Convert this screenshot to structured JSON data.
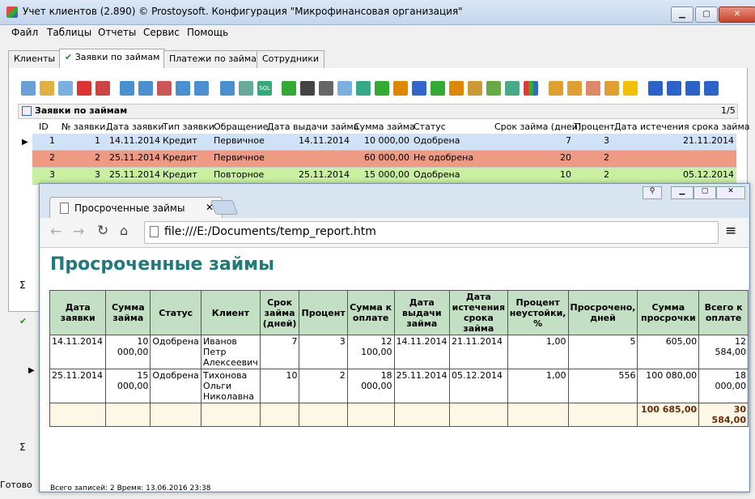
{
  "window": {
    "title": "Учет клиентов (2.890) © Prostoysoft. Конфигурация \"Микрофинансовая организация\""
  },
  "menu": [
    "Файл",
    "Таблицы",
    "Отчеты",
    "Сервис",
    "Помощь"
  ],
  "tabs": [
    "Клиенты",
    "Заявки по займам",
    "Платежи по займам",
    "Сотрудники"
  ],
  "grid": {
    "title": "Заявки по займам",
    "pager": "1/5",
    "columns": [
      "ID",
      "№ заявки",
      "Дата заявки",
      "Тип заявки",
      "Обращение",
      "Дата выдачи займа",
      "Сумма займа",
      "Статус",
      "Срок займа (дней)",
      "Процент",
      "Дата истечения срока займа"
    ],
    "rows": [
      {
        "id": "1",
        "num": "1",
        "date": "14.11.2014",
        "type": "Кредит",
        "appeal": "Первичное",
        "issue": "14.11.2014",
        "sum": "10 000,00",
        "status": "Одобрена",
        "term": "7",
        "pct": "3",
        "expire": "21.11.2014",
        "color": "#cfe2f7"
      },
      {
        "id": "2",
        "num": "2",
        "date": "25.11.2014",
        "type": "Кредит",
        "appeal": "Первичное",
        "issue": "",
        "sum": "60 000,00",
        "status": "Не одобрена",
        "term": "20",
        "pct": "2",
        "expire": "",
        "color": "#ef9b84"
      },
      {
        "id": "3",
        "num": "3",
        "date": "25.11.2014",
        "type": "Кредит",
        "appeal": "Повторное",
        "issue": "25.11.2014",
        "sum": "15 000,00",
        "status": "Одобрена",
        "term": "10",
        "pct": "2",
        "expire": "05.12.2014",
        "color": "#c9f0a0"
      }
    ],
    "sigma": "Σ"
  },
  "status": {
    "text": "Готово"
  },
  "browser": {
    "tab_title": "Просроченные займы",
    "url": "file:///E:/Documents/temp_report.htm",
    "report": {
      "title": "Просроченные займы",
      "headers": [
        "Дата заявки",
        "Сумма займа",
        "Статус",
        "Клиент",
        "Срок займа (дней)",
        "Процент",
        "Сумма к оплате",
        "Дата выдачи займа",
        "Дата истечения срока займа",
        "Процент неустойки, %",
        "Просрочено, дней",
        "Сумма просрочки",
        "Всего к оплате"
      ],
      "rows": [
        [
          "14.11.2014",
          "10 000,00",
          "Одобрена",
          "Иванов Петр Алексеевич",
          "7",
          "3",
          "12 100,00",
          "14.11.2014",
          "21.11.2014",
          "1,00",
          "5",
          "605,00",
          "12 584,00"
        ],
        [
          "25.11.2014",
          "15 000,00",
          "Одобрена",
          "Тихонова Ольги Николавна",
          "10",
          "2",
          "18 000,00",
          "25.11.2014",
          "05.12.2014",
          "1,00",
          "556",
          "100 080,00",
          "18 000,00"
        ]
      ],
      "totals": {
        "overdue_sum": "100 685,00",
        "total_pay": "30 584,00"
      },
      "footer": "Всего записей: 2    Время: 13.06.2016 23:38"
    }
  }
}
